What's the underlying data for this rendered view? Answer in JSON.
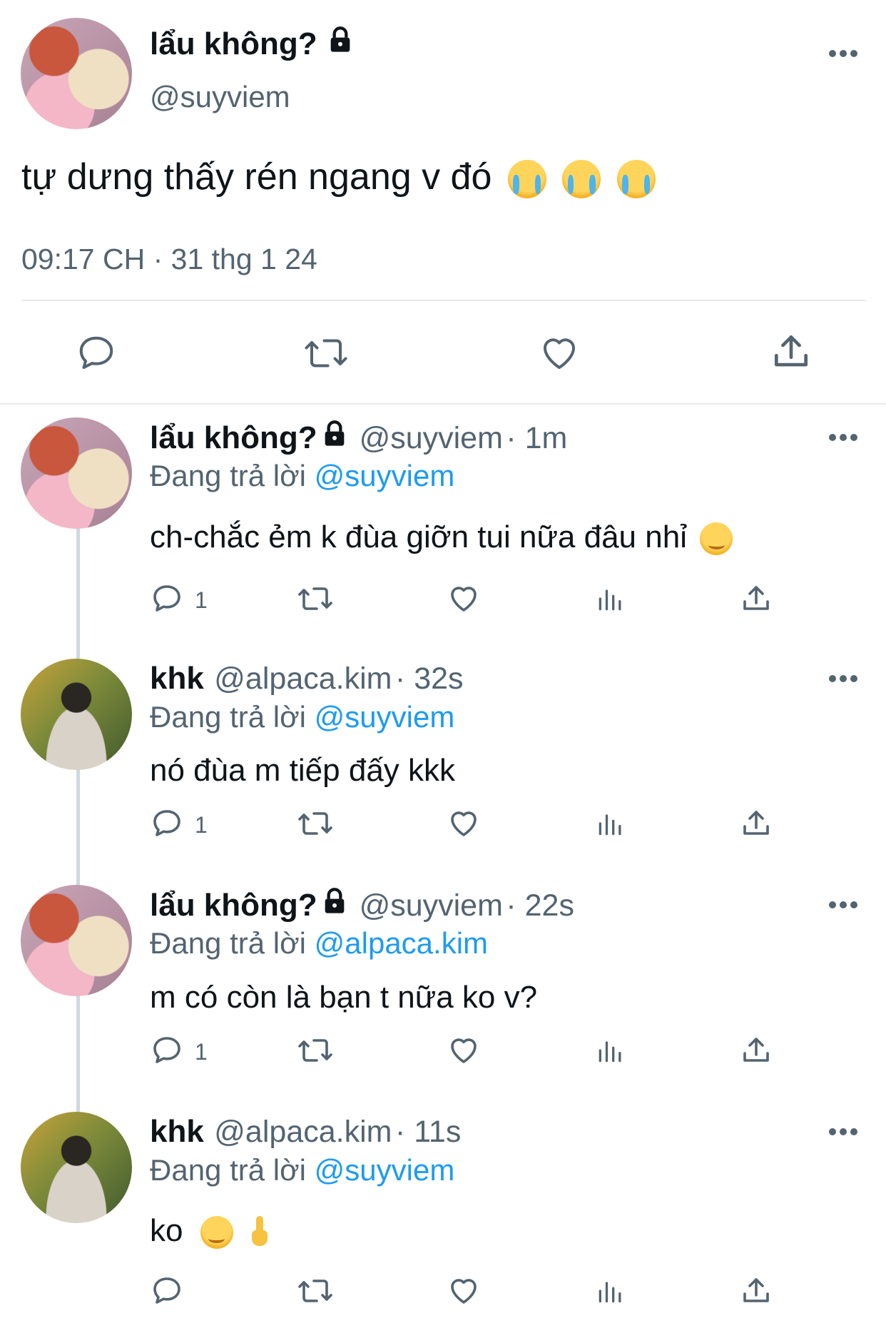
{
  "colors": {
    "text": "#0f1419",
    "muted": "#536471",
    "link": "#1d9bf0",
    "divider": "#e8eaed"
  },
  "main_tweet": {
    "display_name": "lẩu không?",
    "handle": "@suyviem",
    "text": "tự dưng thấy rén ngang v đó",
    "emoji": [
      "loudly-crying-face",
      "loudly-crying-face",
      "loudly-crying-face"
    ],
    "timestamp": "09:17 CH · 31 thg 1 24",
    "actions": [
      "reply",
      "retweet",
      "like",
      "share"
    ]
  },
  "replying_prefix": "Đang trả lời",
  "replies": [
    {
      "display_name": "lẩu không?",
      "handle": "@suyviem",
      "time": "· 1m",
      "replying_to": "@suyviem",
      "text": "ch-chắc ẻm k đùa giỡn tui nữa đâu nhỉ",
      "emoji": [
        "smiling-face"
      ],
      "reply_count": "1",
      "avatar": "cartoon"
    },
    {
      "display_name": "khk",
      "handle": "@alpaca.kim",
      "time": "· 32s",
      "replying_to": "@suyviem",
      "text": "nó đùa m tiếp đấy kkk",
      "emoji": [],
      "reply_count": "1",
      "avatar": "photo"
    },
    {
      "display_name": "lẩu không?",
      "handle": "@suyviem",
      "time": "· 22s",
      "replying_to": "@alpaca.kim",
      "text": "m có còn là bạn t nữa ko v?",
      "emoji": [],
      "reply_count": "1",
      "avatar": "cartoon"
    },
    {
      "display_name": "khk",
      "handle": "@alpaca.kim",
      "time": "· 11s",
      "replying_to": "@suyviem",
      "text": "ko",
      "emoji": [
        "smiling-face",
        "middle-finger"
      ],
      "reply_count": "",
      "avatar": "photo"
    }
  ]
}
